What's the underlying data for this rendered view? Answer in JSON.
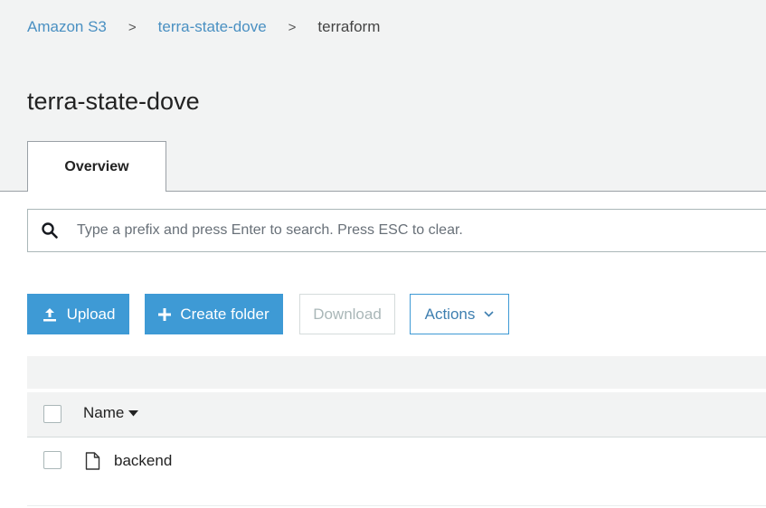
{
  "breadcrumb": {
    "root": "Amazon S3",
    "bucket": "terra-state-dove",
    "current": "terraform",
    "separator": ">"
  },
  "page": {
    "title": "terra-state-dove"
  },
  "tabs": [
    {
      "label": "Overview",
      "active": true
    }
  ],
  "search": {
    "value": "",
    "placeholder": "Type a prefix and press Enter to search. Press ESC to clear.",
    "icon": "search-icon"
  },
  "toolbar": {
    "upload_label": "Upload",
    "upload_icon": "upload-icon",
    "create_folder_label": "Create folder",
    "create_folder_icon": "plus-icon",
    "download_label": "Download",
    "download_enabled": false,
    "actions_label": "Actions",
    "actions_icon": "chevron-down-icon"
  },
  "table": {
    "columns": [
      {
        "label": "Name",
        "sort": "descending"
      }
    ],
    "rows": [
      {
        "name": "backend",
        "type": "file",
        "icon": "file-icon",
        "selected": false
      }
    ]
  },
  "colors": {
    "primary": "#3e9ad5",
    "link": "#4a90c2",
    "disabled_text": "#aab7b8",
    "header_bg": "#f2f3f3"
  }
}
